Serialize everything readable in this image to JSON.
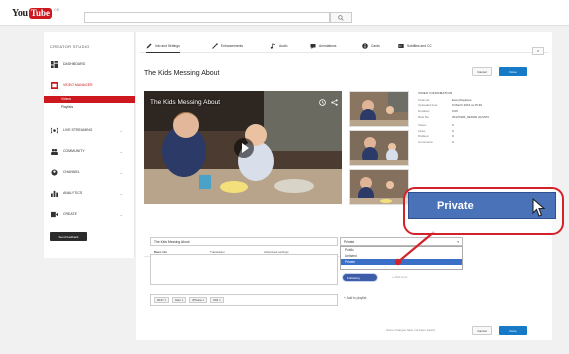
{
  "logo": {
    "you": "You",
    "tube": "Tube",
    "geo": "GB"
  },
  "search": {
    "placeholder": ""
  },
  "sidebar": {
    "title": "CREATOR STUDIO",
    "items": [
      {
        "label": "DASHBOARD",
        "icon": "dashboard-icon"
      },
      {
        "label": "VIDEO MANAGER",
        "icon": "video-manager-icon"
      },
      {
        "label": "LIVE STREAMING",
        "icon": "live-streaming-icon"
      },
      {
        "label": "COMMUNITY",
        "icon": "community-icon"
      },
      {
        "label": "CHANNEL",
        "icon": "channel-icon"
      },
      {
        "label": "ANALYTICS",
        "icon": "analytics-icon"
      },
      {
        "label": "CREATE",
        "icon": "create-icon"
      }
    ],
    "subitems": [
      {
        "label": "Videos",
        "active": true
      },
      {
        "label": "Playlists",
        "active": false
      }
    ],
    "send_feedback": "Send feedback"
  },
  "tabs": [
    {
      "label": "Info and Settings",
      "icon": "pencil-icon"
    },
    {
      "label": "Enhancements",
      "icon": "wand-icon"
    },
    {
      "label": "Audio",
      "icon": "music-note-icon"
    },
    {
      "label": "Annotations",
      "icon": "annotation-icon"
    },
    {
      "label": "Cards",
      "icon": "info-circle-icon"
    },
    {
      "label": "Subtitles and CC",
      "icon": "cc-icon"
    }
  ],
  "more_label": "▾",
  "video": {
    "title": "The Kids Messing About"
  },
  "top_buttons": {
    "cancel": "Cancel",
    "done": "Done"
  },
  "video_info": {
    "heading": "VIDEO INFORMATION",
    "rows": [
      {
        "k": "Channel:",
        "v": "EveryDaybees"
      },
      {
        "k": "Uploaded time:",
        "v": "9 March 2016 at 15:30"
      },
      {
        "k": "Duration:",
        "v": "0:06"
      },
      {
        "k": "Raw file:",
        "v": "20170306_094000 (0).MOV"
      },
      {
        "k": "Views:",
        "v": "0"
      },
      {
        "k": "Likes:",
        "v": "0"
      },
      {
        "k": "Dislikes:",
        "v": "0"
      },
      {
        "k": "Comments:",
        "v": "0"
      }
    ],
    "url_label": "Video URL:",
    "url_value": "https://youtu.be/pRt3WnB9yc"
  },
  "info_tabs": [
    {
      "label": "Basic info",
      "active": true
    },
    {
      "label": "Translation",
      "active": false
    },
    {
      "label": "Advanced settings",
      "active": false
    }
  ],
  "form": {
    "title_value": "The Kids Messing About",
    "tags": [
      "2017 ×",
      "Dan ×",
      "iPhone ×",
      "001 ×"
    ]
  },
  "privacy": {
    "selected": "Private",
    "options": [
      "Public",
      "Unlisted",
      "Private"
    ],
    "highlighted_index": 2,
    "following_label": "Following",
    "add_more": "+ Add more",
    "add_playlist": "+ Add to playlist"
  },
  "bottom": {
    "message": "Some changes have not been saved.",
    "cancel": "Cancel",
    "done": "Done"
  },
  "callout": {
    "label": "Private"
  },
  "colors": {
    "accent": "#cc181e",
    "primary": "#167ac6",
    "callout_border": "#d2232a",
    "callout_fill": "#4a72b8"
  }
}
